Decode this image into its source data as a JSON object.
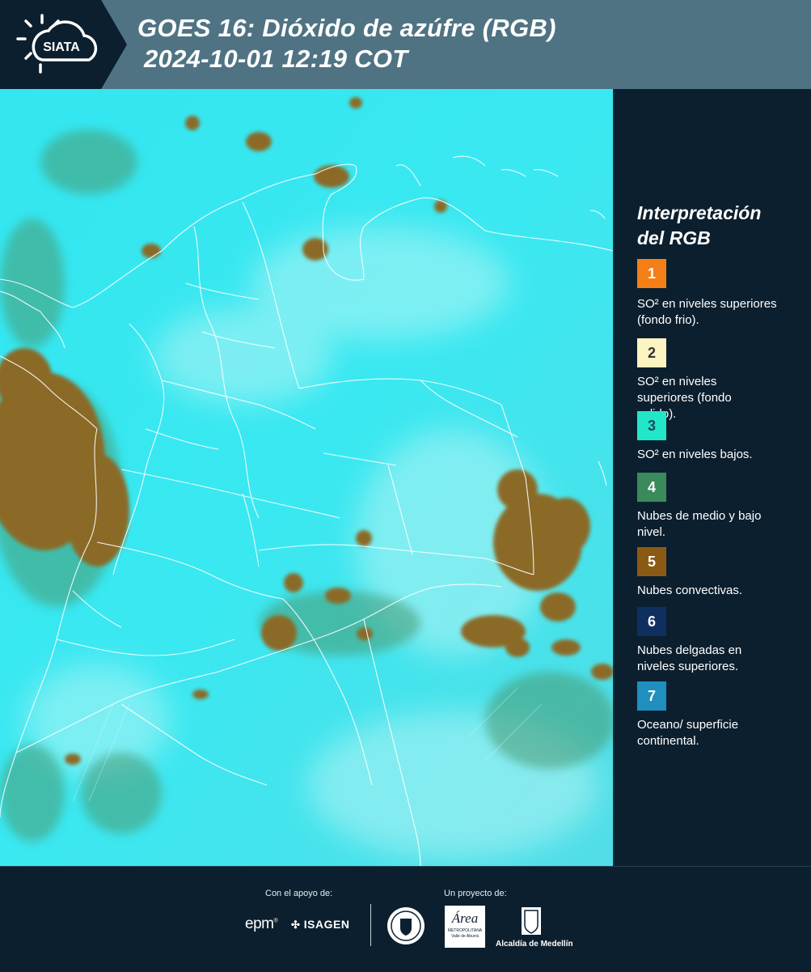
{
  "header": {
    "logo_text": "SIATA",
    "title_line1": "GOES 16: Dióxido de azúfre (RGB)",
    "title_line2": "2024-10-01 12:19 COT"
  },
  "legend": {
    "title_line1": "Interpretación",
    "title_line2": "del RGB",
    "items": [
      {
        "number": "1",
        "label": "SO² en niveles superiores (fondo frio).",
        "color": "#f57f17",
        "text_color": "#ffffff"
      },
      {
        "number": "2",
        "label": "SO² en niveles superiores (fondo calido).",
        "color": "#fbf3c0",
        "text_color": "#333333"
      },
      {
        "number": "3",
        "label": "SO² en niveles bajos.",
        "color": "#22e6c8",
        "text_color": "#1b4a55"
      },
      {
        "number": "4",
        "label": "Nubes de medio y bajo nivel.",
        "color": "#3a8a5c",
        "text_color": "#ffffff"
      },
      {
        "number": "5",
        "label": "Nubes convectivas.",
        "color": "#8a5a14",
        "text_color": "#ffffff"
      },
      {
        "number": "6",
        "label": "Nubes delgadas en niveles superiores.",
        "color": "#0f2f60",
        "text_color": "#ffffff"
      },
      {
        "number": "7",
        "label": "Oceano/ superficie continental.",
        "color": "#1f8fbf",
        "text_color": "#ffffff"
      }
    ]
  },
  "footer": {
    "support_label": "Con el apoyo de:",
    "project_label": "Un proyecto de:",
    "sponsor_epm": "epm",
    "sponsor_isagen": "ISAGEN",
    "area_text": "Área",
    "area_sub": "METROPOLITANA",
    "area_sub2": "Valle de Aburrá",
    "alcaldia": "Alcaldía de Medellín"
  },
  "colors": {
    "background": "#0c1f2e",
    "title_band": "#4f7383",
    "map_base": "#2fe3ee",
    "cloud": "#8a6a25"
  }
}
